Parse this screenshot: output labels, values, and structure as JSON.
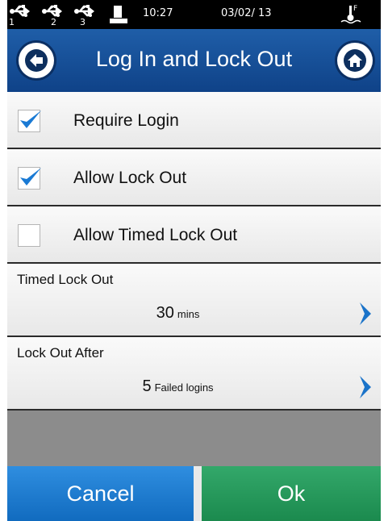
{
  "status_bar": {
    "usb_ports": [
      "1",
      "2",
      "3"
    ],
    "time": "10:27",
    "date": "03/02/ 13",
    "icons": [
      "usb-icon",
      "printer-icon",
      "sensor-icon"
    ]
  },
  "header": {
    "title": "Log In and Lock Out",
    "back_icon": "back-arrow-icon",
    "home_icon": "home-icon"
  },
  "options": [
    {
      "label": "Require Login",
      "checked": true
    },
    {
      "label": "Allow Lock Out",
      "checked": true
    },
    {
      "label": "Allow Timed Lock Out",
      "checked": false
    }
  ],
  "settings": [
    {
      "title": "Timed Lock Out",
      "value": "30",
      "unit": "mins"
    },
    {
      "title": "Lock Out After",
      "value": "5",
      "unit": "Failed logins"
    }
  ],
  "footer": {
    "cancel_label": "Cancel",
    "ok_label": "Ok"
  },
  "colors": {
    "header_blue": "#1f5ea8",
    "check_blue": "#1a7ad4",
    "cancel_blue": "#1e7fd6",
    "ok_green": "#239455",
    "chevron_blue": "#1a73c9"
  }
}
